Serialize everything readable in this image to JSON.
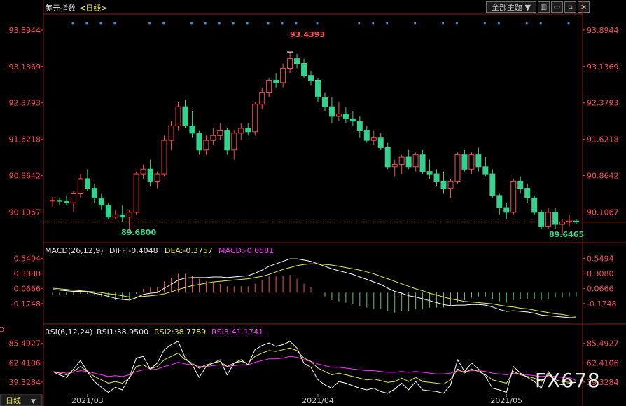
{
  "header": {
    "symbol": "美元指数",
    "period": "<日线>",
    "theme_select": "全部主题",
    "theme_arrow": "▼"
  },
  "colors": {
    "up": "#ff4a4a",
    "down": "#33d38f",
    "diff": "#ffffff",
    "dea": "#e8e85a",
    "rsi3": "#ff33ff",
    "blue_dots": "#3a8fe0",
    "axis_text": "#ff4a4a"
  },
  "chart_data": [
    {
      "type": "candlestick",
      "title": "美元指数 <日线>",
      "y_ticks": [
        "93.8944",
        "93.1369",
        "92.3793",
        "91.6218",
        "90.8642",
        "90.1067"
      ],
      "ylim": [
        89.5,
        94.2
      ],
      "x_ticks": [
        "2021/03",
        "2021/04",
        "2021/05"
      ],
      "annotations": {
        "high_label": "93.4393",
        "low_label": "89.6800",
        "last_low_label": "89.6465"
      },
      "reference_price": 89.9,
      "ohlc": [
        [
          90.35,
          90.42,
          90.22,
          90.35
        ],
        [
          90.35,
          90.4,
          90.25,
          90.33
        ],
        [
          90.33,
          90.45,
          90.25,
          90.3
        ],
        [
          90.3,
          90.55,
          90.1,
          90.5
        ],
        [
          90.5,
          90.9,
          90.4,
          90.8
        ],
        [
          90.8,
          91.0,
          90.55,
          90.6
        ],
        [
          90.6,
          90.7,
          90.3,
          90.4
        ],
        [
          90.4,
          90.5,
          90.15,
          90.25
        ],
        [
          90.25,
          90.3,
          89.95,
          90.0
        ],
        [
          90.0,
          90.15,
          89.95,
          90.05
        ],
        [
          90.05,
          90.25,
          89.9,
          90.0
        ],
        [
          90.0,
          90.15,
          89.68,
          90.1
        ],
        [
          90.1,
          90.95,
          90.05,
          90.9
        ],
        [
          90.9,
          91.1,
          90.8,
          91.0
        ],
        [
          91.0,
          91.2,
          90.65,
          90.75
        ],
        [
          90.75,
          90.95,
          90.6,
          90.9
        ],
        [
          90.9,
          91.7,
          90.85,
          91.6
        ],
        [
          91.6,
          92.0,
          91.4,
          91.9
        ],
        [
          91.9,
          92.4,
          91.8,
          92.3
        ],
        [
          92.3,
          92.45,
          91.85,
          91.9
        ],
        [
          91.9,
          92.2,
          91.65,
          91.75
        ],
        [
          91.75,
          91.8,
          91.3,
          91.4
        ],
        [
          91.4,
          91.7,
          91.3,
          91.6
        ],
        [
          91.6,
          91.85,
          91.5,
          91.7
        ],
        [
          91.7,
          91.95,
          91.6,
          91.8
        ],
        [
          91.8,
          91.85,
          91.3,
          91.4
        ],
        [
          91.4,
          91.8,
          91.2,
          91.75
        ],
        [
          91.75,
          91.95,
          91.6,
          91.85
        ],
        [
          91.85,
          91.95,
          91.7,
          91.78
        ],
        [
          91.78,
          92.4,
          91.7,
          92.35
        ],
        [
          92.35,
          92.7,
          92.25,
          92.6
        ],
        [
          92.6,
          92.9,
          92.5,
          92.85
        ],
        [
          92.85,
          93.0,
          92.7,
          92.8
        ],
        [
          92.8,
          93.2,
          92.7,
          93.1
        ],
        [
          93.1,
          93.44,
          93.0,
          93.3
        ],
        [
          93.3,
          93.4,
          93.1,
          93.2
        ],
        [
          93.2,
          93.3,
          92.9,
          92.95
        ],
        [
          92.95,
          93.05,
          92.75,
          92.85
        ],
        [
          92.85,
          92.9,
          92.4,
          92.5
        ],
        [
          92.5,
          92.6,
          92.2,
          92.3
        ],
        [
          92.3,
          92.5,
          91.95,
          92.1
        ],
        [
          92.1,
          92.4,
          92.0,
          92.15
        ],
        [
          92.15,
          92.3,
          91.95,
          92.05
        ],
        [
          92.05,
          92.2,
          91.9,
          92.0
        ],
        [
          92.0,
          92.1,
          91.65,
          91.8
        ],
        [
          91.8,
          91.9,
          91.55,
          91.6
        ],
        [
          91.6,
          91.8,
          91.5,
          91.65
        ],
        [
          91.65,
          91.75,
          91.4,
          91.45
        ],
        [
          91.45,
          91.55,
          91.0,
          91.05
        ],
        [
          91.05,
          91.2,
          90.85,
          91.1
        ],
        [
          91.1,
          91.3,
          90.9,
          91.25
        ],
        [
          91.25,
          91.4,
          91.0,
          91.05
        ],
        [
          91.05,
          91.35,
          90.95,
          91.3
        ],
        [
          91.3,
          91.4,
          90.9,
          90.95
        ],
        [
          90.95,
          91.2,
          90.8,
          90.9
        ],
        [
          90.9,
          91.0,
          90.65,
          90.75
        ],
        [
          90.75,
          90.95,
          90.5,
          90.6
        ],
        [
          90.6,
          90.8,
          90.4,
          90.75
        ],
        [
          90.75,
          91.35,
          90.7,
          91.3
        ],
        [
          91.3,
          91.4,
          90.95,
          91.0
        ],
        [
          91.0,
          91.35,
          90.9,
          91.3
        ],
        [
          91.3,
          91.45,
          90.95,
          91.05
        ],
        [
          91.05,
          91.25,
          90.85,
          90.9
        ],
        [
          90.9,
          91.0,
          90.4,
          90.45
        ],
        [
          90.45,
          90.5,
          90.05,
          90.2
        ],
        [
          90.2,
          90.3,
          89.95,
          90.1
        ],
        [
          90.1,
          90.8,
          90.05,
          90.75
        ],
        [
          90.75,
          90.85,
          90.5,
          90.6
        ],
        [
          90.6,
          90.7,
          90.3,
          90.4
        ],
        [
          90.4,
          90.45,
          90.05,
          90.1
        ],
        [
          90.1,
          90.15,
          89.75,
          89.8
        ],
        [
          89.8,
          90.2,
          89.75,
          90.1
        ],
        [
          90.1,
          90.2,
          89.75,
          89.85
        ],
        [
          89.85,
          89.95,
          89.65,
          89.9
        ],
        [
          89.9,
          90.05,
          89.8,
          89.92
        ],
        [
          89.92,
          89.95,
          89.85,
          89.9
        ]
      ]
    },
    {
      "type": "line",
      "title": "MACD(26,12,9)",
      "labels": {
        "diff": "DIFF:-0.4048",
        "dea": "DEA:-0.3757",
        "macd": "MACD:-0.0581"
      },
      "y_ticks": [
        "0.5494",
        "0.3080",
        "0.0666",
        "-0.1748"
      ],
      "ylim": [
        -0.48,
        0.62
      ],
      "diff": [
        0.05,
        0.04,
        0.03,
        0.02,
        0.02,
        0.01,
        -0.01,
        -0.03,
        -0.06,
        -0.09,
        -0.11,
        -0.12,
        -0.08,
        -0.03,
        -0.01,
        0.0,
        0.07,
        0.13,
        0.2,
        0.23,
        0.24,
        0.24,
        0.24,
        0.25,
        0.25,
        0.24,
        0.25,
        0.26,
        0.27,
        0.31,
        0.36,
        0.42,
        0.46,
        0.5,
        0.54,
        0.54,
        0.52,
        0.5,
        0.46,
        0.42,
        0.38,
        0.35,
        0.32,
        0.29,
        0.25,
        0.21,
        0.17,
        0.13,
        0.07,
        0.02,
        -0.01,
        -0.05,
        -0.07,
        -0.1,
        -0.13,
        -0.16,
        -0.19,
        -0.21,
        -0.2,
        -0.2,
        -0.19,
        -0.19,
        -0.2,
        -0.23,
        -0.27,
        -0.3,
        -0.29,
        -0.3,
        -0.31,
        -0.33,
        -0.36,
        -0.37,
        -0.38,
        -0.39,
        -0.4,
        -0.4
      ],
      "dea": [
        0.07,
        0.06,
        0.05,
        0.04,
        0.03,
        0.02,
        0.01,
        0.0,
        -0.02,
        -0.03,
        -0.05,
        -0.07,
        -0.07,
        -0.06,
        -0.05,
        -0.04,
        -0.02,
        0.01,
        0.05,
        0.08,
        0.11,
        0.13,
        0.15,
        0.17,
        0.18,
        0.19,
        0.2,
        0.21,
        0.22,
        0.24,
        0.26,
        0.29,
        0.33,
        0.37,
        0.4,
        0.43,
        0.45,
        0.46,
        0.46,
        0.45,
        0.44,
        0.42,
        0.4,
        0.38,
        0.36,
        0.33,
        0.3,
        0.26,
        0.22,
        0.18,
        0.14,
        0.1,
        0.06,
        0.03,
        -0.01,
        -0.04,
        -0.07,
        -0.1,
        -0.12,
        -0.14,
        -0.15,
        -0.16,
        -0.17,
        -0.18,
        -0.2,
        -0.22,
        -0.23,
        -0.25,
        -0.26,
        -0.28,
        -0.3,
        -0.32,
        -0.34,
        -0.35,
        -0.37,
        -0.38
      ],
      "macd": [
        -0.04,
        -0.04,
        -0.04,
        -0.04,
        -0.02,
        -0.02,
        -0.04,
        -0.06,
        -0.08,
        -0.12,
        -0.12,
        -0.1,
        -0.02,
        0.06,
        0.08,
        0.08,
        0.18,
        0.24,
        0.3,
        0.3,
        0.26,
        0.22,
        0.18,
        0.16,
        0.14,
        0.1,
        0.1,
        0.1,
        0.1,
        0.14,
        0.2,
        0.26,
        0.26,
        0.26,
        0.28,
        0.22,
        0.14,
        0.08,
        0.0,
        -0.06,
        -0.12,
        -0.14,
        -0.16,
        -0.18,
        -0.22,
        -0.24,
        -0.26,
        -0.26,
        -0.3,
        -0.32,
        -0.3,
        -0.3,
        -0.26,
        -0.26,
        -0.24,
        -0.24,
        -0.24,
        -0.22,
        -0.16,
        -0.12,
        -0.08,
        -0.06,
        -0.06,
        -0.1,
        -0.14,
        -0.16,
        -0.12,
        -0.1,
        -0.1,
        -0.1,
        -0.12,
        -0.1,
        -0.08,
        -0.08,
        -0.06,
        -0.06
      ]
    },
    {
      "type": "line",
      "title": "RSI(6,12,24)",
      "labels": {
        "rsi1": "RSI1:38.9500",
        "rsi2": "RSI2:38.7789",
        "rsi3": "RSI3:41.1741"
      },
      "y_ticks": [
        "85.4927",
        "62.4106",
        "39.3284"
      ],
      "ylim": [
        25,
        97
      ],
      "rsi1": [
        52,
        48,
        45,
        55,
        65,
        52,
        40,
        33,
        27,
        33,
        30,
        45,
        68,
        70,
        55,
        62,
        78,
        84,
        88,
        68,
        60,
        45,
        58,
        62,
        66,
        48,
        62,
        66,
        60,
        78,
        83,
        86,
        82,
        84,
        88,
        80,
        62,
        57,
        42,
        36,
        32,
        40,
        38,
        35,
        32,
        30,
        32,
        28,
        26,
        31,
        38,
        30,
        40,
        30,
        29,
        28,
        26,
        36,
        66,
        52,
        62,
        55,
        46,
        32,
        30,
        27,
        58,
        50,
        45,
        40,
        32,
        52,
        38,
        36,
        38,
        39
      ],
      "rsi2": [
        52,
        50,
        48,
        52,
        58,
        52,
        46,
        42,
        38,
        40,
        38,
        44,
        58,
        60,
        55,
        58,
        66,
        70,
        74,
        66,
        62,
        56,
        60,
        62,
        64,
        58,
        62,
        64,
        62,
        70,
        74,
        77,
        76,
        78,
        80,
        77,
        68,
        64,
        56,
        52,
        48,
        50,
        48,
        46,
        44,
        42,
        43,
        41,
        39,
        40,
        44,
        40,
        45,
        40,
        39,
        38,
        37,
        42,
        55,
        50,
        55,
        52,
        48,
        42,
        40,
        38,
        52,
        48,
        46,
        44,
        40,
        48,
        42,
        40,
        39,
        39
      ],
      "rsi3": [
        52,
        51,
        50,
        51,
        53,
        52,
        50,
        48,
        46,
        47,
        46,
        48,
        52,
        54,
        54,
        55,
        58,
        60,
        63,
        61,
        60,
        58,
        58,
        59,
        60,
        58,
        59,
        60,
        60,
        63,
        65,
        67,
        67,
        68,
        70,
        69,
        66,
        64,
        61,
        59,
        57,
        57,
        56,
        55,
        54,
        53,
        53,
        52,
        51,
        51,
        52,
        51,
        52,
        51,
        50,
        49,
        49,
        50,
        53,
        52,
        53,
        53,
        52,
        50,
        49,
        48,
        50,
        49,
        48,
        47,
        46,
        47,
        46,
        45,
        45,
        41
      ]
    }
  ]
}
